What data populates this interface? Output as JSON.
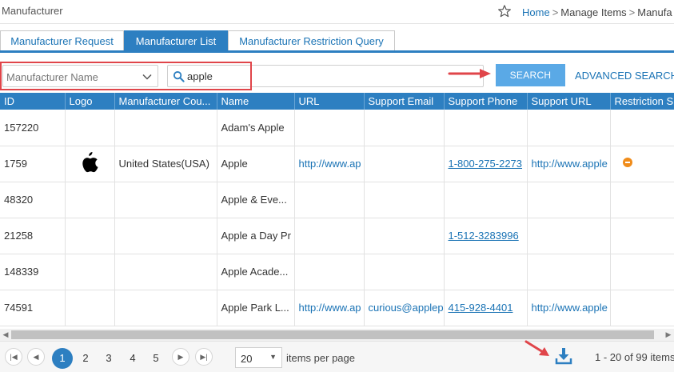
{
  "header": {
    "title": "Manufacturer",
    "breadcrumb": {
      "home": "Home",
      "sep": ">",
      "manage": "Manage Items",
      "current": "Manufa"
    }
  },
  "tabs": [
    {
      "label": "Manufacturer Request"
    },
    {
      "label": "Manufacturer List"
    },
    {
      "label": "Manufacturer Restriction Query"
    }
  ],
  "filter": {
    "field_value": "Manufacturer Name",
    "search_value": "apple",
    "search_button": "SEARCH",
    "advanced_link": "ADVANCED SEARCH"
  },
  "table": {
    "columns": [
      "ID",
      "Logo",
      "Manufacturer Cou...",
      "Name",
      "URL",
      "Support Email",
      "Support Phone",
      "Support URL",
      "Restriction S"
    ],
    "rows": [
      {
        "id": "157220",
        "country": "",
        "name": "Adam's Apple",
        "url": "",
        "email": "",
        "phone": "",
        "support_url": ""
      },
      {
        "id": "1759",
        "country": "United States(USA)",
        "name": "Apple",
        "url": "http://www.ap",
        "email": "",
        "phone": "1-800-275-2273",
        "support_url": "http://www.apple"
      },
      {
        "id": "48320",
        "country": "",
        "name": "Apple & Eve...",
        "url": "",
        "email": "",
        "phone": "",
        "support_url": ""
      },
      {
        "id": "21258",
        "country": "",
        "name": "Apple a Day Pr",
        "url": "",
        "email": "",
        "phone": "1-512-3283996",
        "support_url": ""
      },
      {
        "id": "148339",
        "country": "",
        "name": "Apple Acade...",
        "url": "",
        "email": "",
        "phone": "",
        "support_url": ""
      },
      {
        "id": "74591",
        "country": "",
        "name": "Apple Park L...",
        "url": "http://www.ap",
        "email": "curious@applep",
        "phone": "415-928-4401",
        "support_url": "http://www.apple"
      }
    ]
  },
  "pager": {
    "pages": [
      "1",
      "2",
      "3",
      "4",
      "5"
    ],
    "active_page": "1",
    "per_page": "20",
    "per_page_label": "items per page",
    "range": "1 - 20 of 99 items"
  },
  "colors": {
    "accent": "#2d7fc1",
    "search_button": "#5aa9e6",
    "annotation": "#e0454a",
    "restriction": "#f08c1a"
  }
}
